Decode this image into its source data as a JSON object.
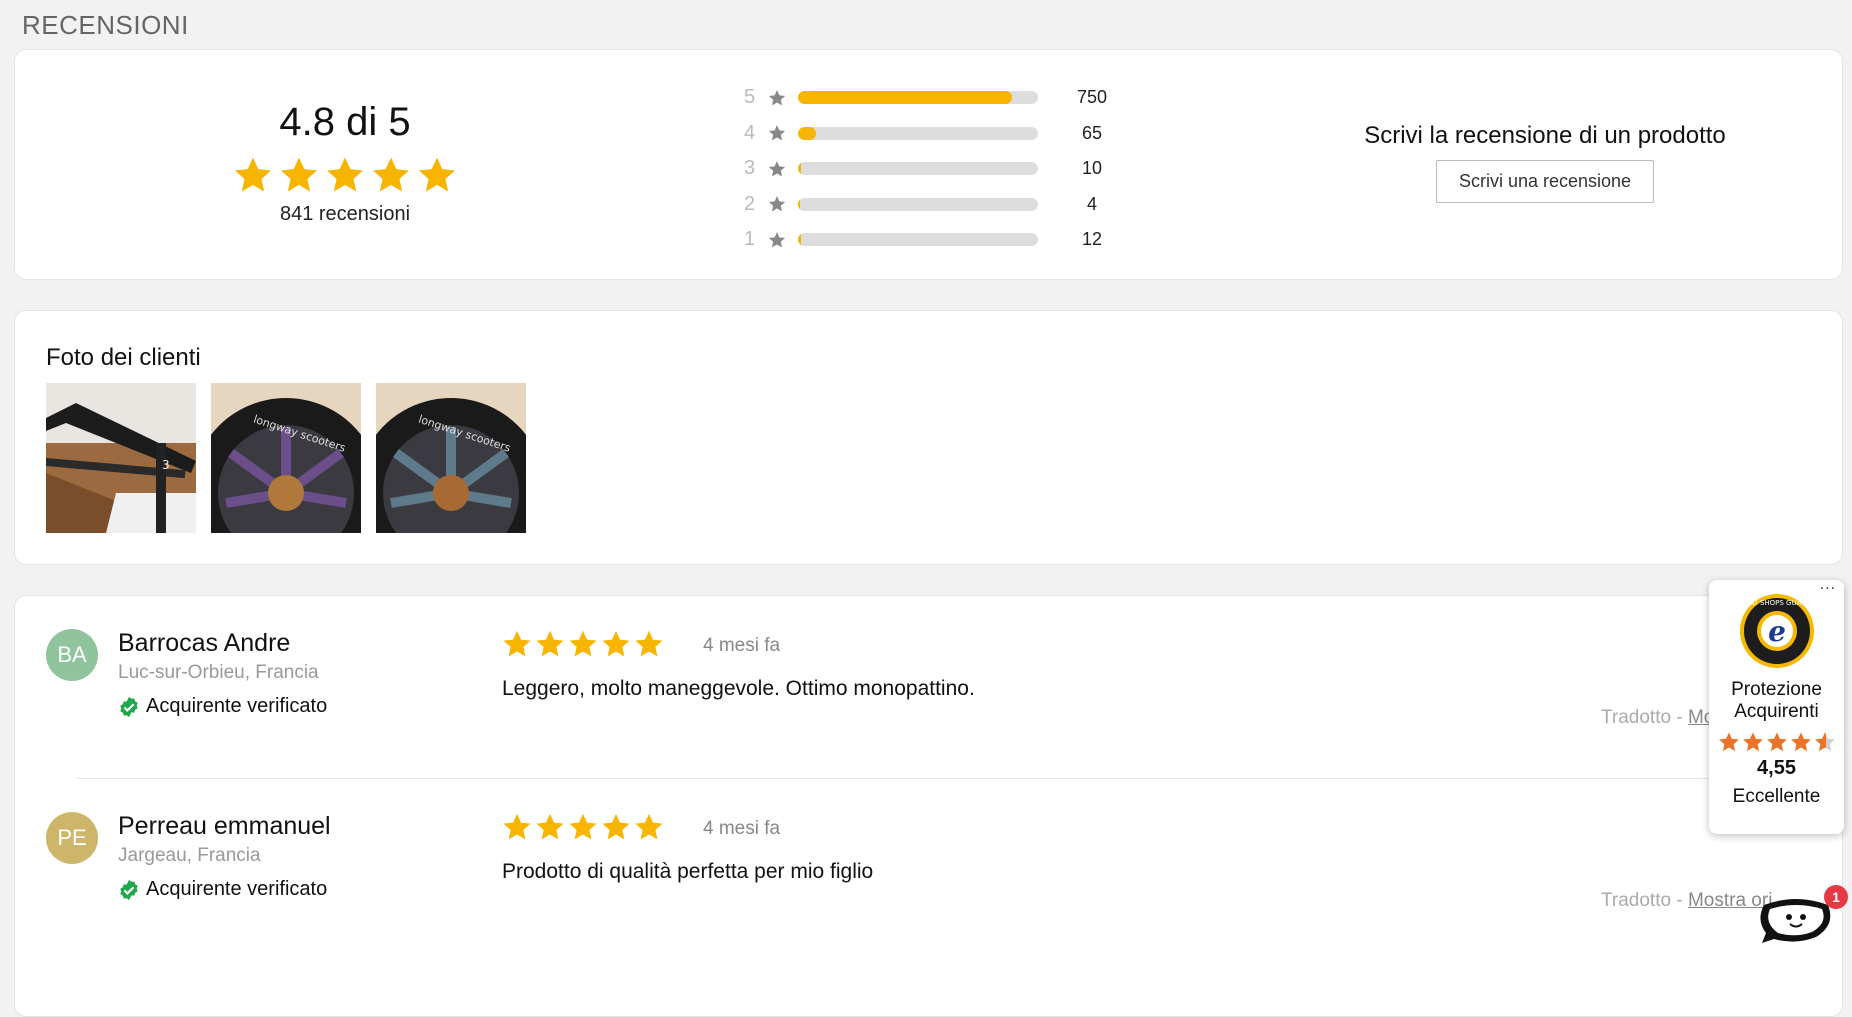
{
  "section_title": "RECENSIONI",
  "summary": {
    "average_text": "4.8 di 5",
    "average_value": 4.8,
    "stars_filled": 5,
    "review_count_text": "841 recensioni",
    "distribution": [
      {
        "label": "5",
        "count": "750",
        "fraction": 0.89
      },
      {
        "label": "4",
        "count": "65",
        "fraction": 0.077
      },
      {
        "label": "3",
        "count": "10",
        "fraction": 0.012
      },
      {
        "label": "2",
        "count": "4",
        "fraction": 0.005
      },
      {
        "label": "1",
        "count": "12",
        "fraction": 0.014
      }
    ],
    "write_title": "Scrivi la recensione di un prodotto",
    "write_button": "Scrivi una recensione"
  },
  "photos": {
    "title": "Foto dei clienti",
    "items": [
      "scooter-deck-photo",
      "scooter-wheel-photo",
      "scooter-wheel-photo"
    ]
  },
  "reviews": [
    {
      "initials": "BA",
      "avatar_color": "#8fc49c",
      "name": "Barrocas Andre",
      "location": "Luc-sur-Orbieu, Francia",
      "verified": "Acquirente verificato",
      "stars": 5,
      "date": "4 mesi fa",
      "text": "Leggero, molto maneggevole. Ottimo monopattino.",
      "translated": "Tradotto - ",
      "show_original": "Mostra ori"
    },
    {
      "initials": "PE",
      "avatar_color": "#cdb66a",
      "name": "Perreau emmanuel",
      "location": "Jargeau, Francia",
      "verified": "Acquirente verificato",
      "stars": 5,
      "date": "4 mesi fa",
      "text": "Prodotto di qualità perfetta per mio figlio",
      "translated": "Tradotto - ",
      "show_original": "Mostra ori"
    }
  ],
  "trusted_shops": {
    "more": "...",
    "label_line1": "Protezione",
    "label_line2": "Acquirenti",
    "score": "4,55",
    "rating_text": "Eccellente",
    "seal_text": "TRUSTED SHOPS GUARANTEE"
  },
  "chat": {
    "badge_count": "1"
  },
  "colors": {
    "star": "#f7b500",
    "star_grey": "#888888",
    "bar_track": "#dddddd",
    "verified": "#1fa84a",
    "ts_star": "#e8752a"
  }
}
